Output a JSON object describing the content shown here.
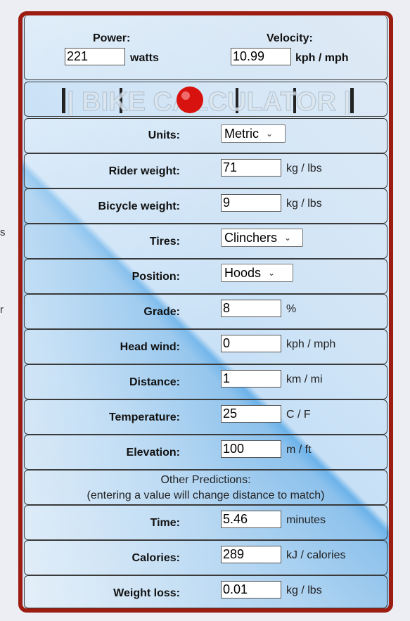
{
  "edge": {
    "s": "s",
    "r": "r"
  },
  "power": {
    "heading": "Power:",
    "value": "221",
    "unit": "watts"
  },
  "velocity": {
    "heading": "Velocity:",
    "value": "10.99",
    "unit": "kph / mph"
  },
  "logo": {
    "text": "| BIKE CALCULATOR |",
    "accent": "#d8120f"
  },
  "rows": {
    "units": {
      "label": "Units:",
      "value": "Metric"
    },
    "rider_weight": {
      "label": "Rider weight:",
      "value": "71",
      "unit": "kg / lbs"
    },
    "bicycle_weight": {
      "label": "Bicycle weight:",
      "value": "9",
      "unit": "kg / lbs"
    },
    "tires": {
      "label": "Tires:",
      "value": "Clinchers"
    },
    "position": {
      "label": "Position:",
      "value": "Hoods"
    },
    "grade": {
      "label": "Grade:",
      "value": "8",
      "unit": "%"
    },
    "head_wind": {
      "label": "Head wind:",
      "value": "0",
      "unit": "kph / mph"
    },
    "distance": {
      "label": "Distance:",
      "value": "1",
      "unit": "km / mi"
    },
    "temperature": {
      "label": "Temperature:",
      "value": "25",
      "unit": "C / F"
    },
    "elevation": {
      "label": "Elevation:",
      "value": "100",
      "unit": "m / ft"
    }
  },
  "predictions": {
    "title": "Other Predictions:",
    "note": "(entering a value will change distance to match)",
    "time": {
      "label": "Time:",
      "value": "5.46",
      "unit": "minutes"
    },
    "calories": {
      "label": "Calories:",
      "value": "289",
      "unit": "kJ / calories"
    },
    "weight_loss": {
      "label": "Weight loss:",
      "value": "0.01",
      "unit": "kg / lbs"
    }
  }
}
